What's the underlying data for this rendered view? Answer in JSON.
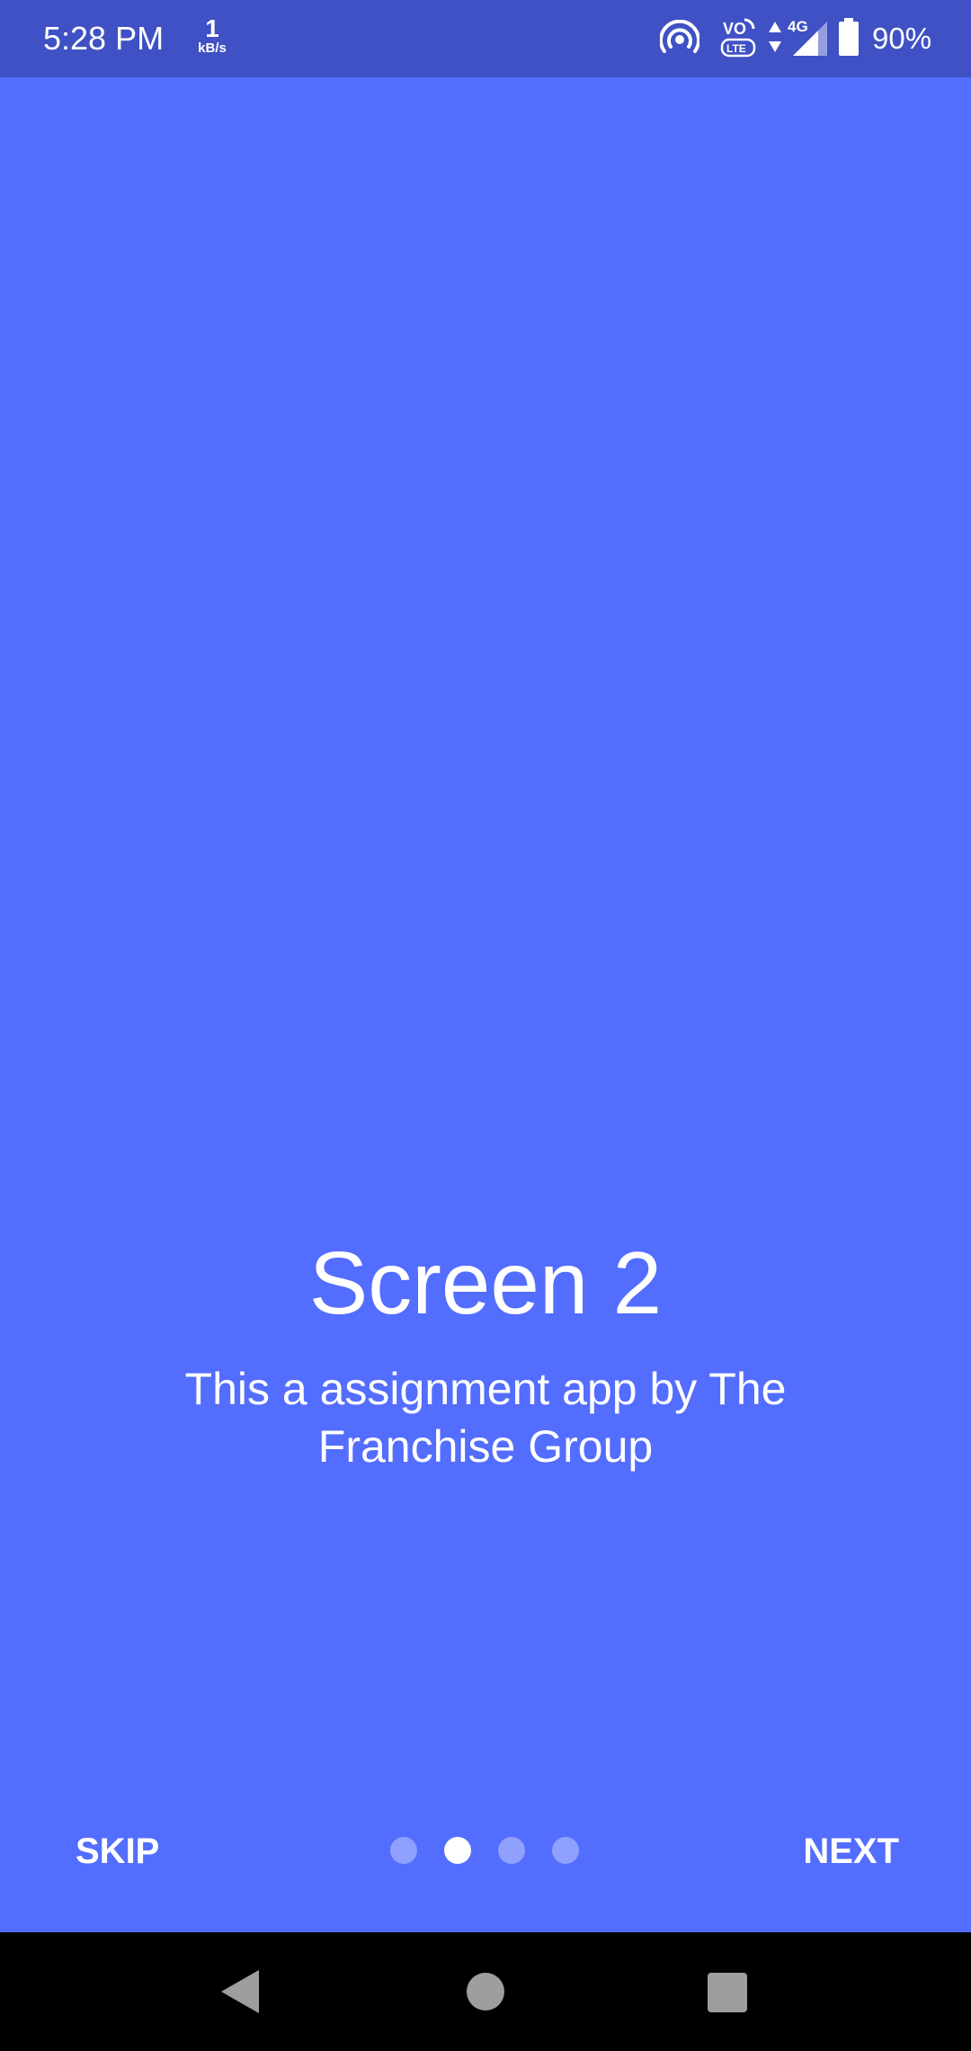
{
  "status_bar": {
    "time": "5:28 PM",
    "net_speed_value": "1",
    "net_speed_unit": "kB/s",
    "battery_percent": "90%",
    "icons": [
      "hotspot-icon",
      "volte-icon",
      "data-arrows-icon",
      "4g-signal-icon",
      "battery-icon"
    ],
    "network_label": "4G",
    "volte_label_top": "VO",
    "volte_label_bottom": "LTE"
  },
  "slide": {
    "title": "Screen 2",
    "description": "This a assignment app by The Franchise Group"
  },
  "controls": {
    "skip_label": "SKIP",
    "next_label": "NEXT",
    "page_count": 4,
    "active_page": 2
  },
  "nav_bar": {
    "icons": [
      "back-icon",
      "home-icon",
      "recents-icon"
    ]
  },
  "colors": {
    "background": "#536dfe",
    "status_bar": "#3f51c4",
    "nav_bar": "#000000",
    "text": "#ffffff"
  }
}
